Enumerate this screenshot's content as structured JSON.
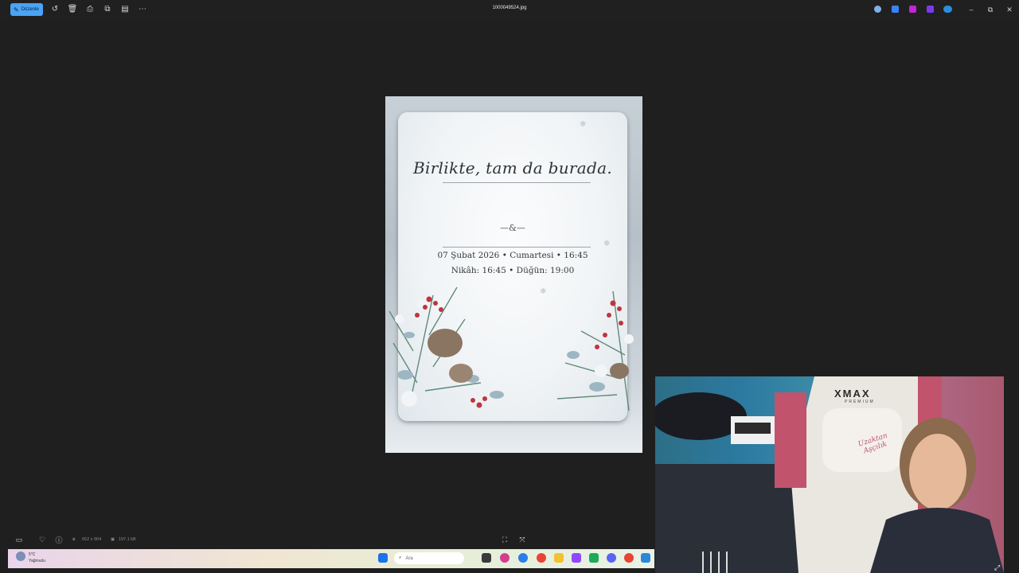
{
  "toolbar": {
    "edit_label": "Düzenle",
    "file_title": "1000049524.jpg"
  },
  "invitation": {
    "heading": "Birlikte, tam da burada.",
    "ampersand": "—&—",
    "date_line": "07 Şubat 2026 • Cumartesi • 16:45",
    "times_line": "Nikâh: 16:45 • Düğün: 19:00"
  },
  "status": {
    "dimensions": "652 x 904",
    "file_size": "197.1 kB"
  },
  "taskbar": {
    "weather_temp": "5°C",
    "weather_desc": "Yağmurlu",
    "search_placeholder": "Ara"
  },
  "webcam": {
    "chair_brand": "XMAX",
    "chair_sub": "PREMIUM",
    "pillow_text": "Uzaktan Aşçılık"
  },
  "colors": {
    "accent": "#4aa3f5",
    "background": "#1f1f1f"
  }
}
